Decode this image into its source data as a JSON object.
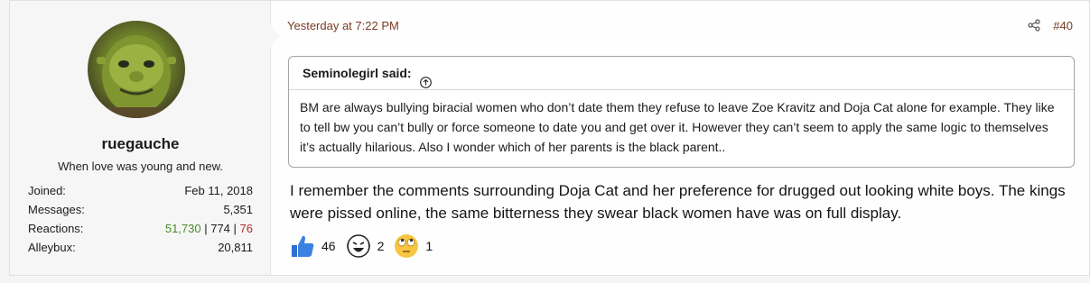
{
  "user": {
    "name": "ruegauche",
    "title": "When love was young and new.",
    "stats": [
      {
        "label": "Joined:",
        "value": "Feb 11, 2018"
      },
      {
        "label": "Messages:",
        "value": "5,351"
      },
      {
        "label": "Alleybux:",
        "value": "20,811"
      }
    ],
    "reactions_label": "Reactions:",
    "reactions_pos": "51,730",
    "reactions_sep1": " | ",
    "reactions_neu": "774",
    "reactions_sep2": " | ",
    "reactions_neg": "76"
  },
  "post": {
    "date": "Yesterday at 7:22 PM",
    "number": "#40",
    "quote_author": "Seminolegirl said:",
    "quote_text": "BM are always bullying biracial women who don’t date them they refuse to leave Zoe Kravitz and Doja Cat alone for example. They like to tell bw you can’t bully or force someone to date you and get over it. However they can’t seem to apply the same logic to themselves it’s actually hilarious. Also I wonder which of her parents is the black parent..",
    "message": "I remember the comments surrounding Doja Cat and her preference for drugged out looking white boys. The kings were pissed online, the same bitterness they swear black women have was on full display.",
    "reactions": [
      {
        "icon": "thumbs-up-icon",
        "count": "46"
      },
      {
        "icon": "laughing-face-icon",
        "count": "2"
      },
      {
        "icon": "eye-roll-face-icon",
        "count": "1"
      }
    ]
  },
  "colors": {
    "link": "#7a3b23",
    "positive": "#4a8a2a",
    "negative": "#b22a2a"
  }
}
